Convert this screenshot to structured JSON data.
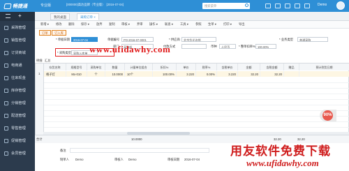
{
  "app": {
    "name": "畅捷通",
    "edition": "专业版",
    "info": "[000000]高达品牌（专业版）　[2016-07-04]"
  },
  "topbar": {
    "search_placeholder": "搜索菜单",
    "user": "Demo"
  },
  "sidebar": {
    "home_glyph": "+",
    "items": [
      {
        "label": "采购管理",
        "icon": "cart-icon"
      },
      {
        "label": "销售管理",
        "icon": "tag-icon"
      },
      {
        "label": "订货商城",
        "icon": "shop-icon"
      },
      {
        "label": "电商通",
        "icon": "globe-icon"
      },
      {
        "label": "往来现金",
        "icon": "wallet-icon"
      },
      {
        "label": "库存管理",
        "icon": "box-icon"
      },
      {
        "label": "分销管理",
        "icon": "branch-icon"
      },
      {
        "label": "配送管理",
        "icon": "truck-icon"
      },
      {
        "label": "零售管理",
        "icon": "store-icon"
      },
      {
        "label": "促销管理",
        "icon": "gift-icon"
      },
      {
        "label": "会员管理",
        "icon": "user-icon"
      }
    ]
  },
  "tabs": [
    {
      "label": "我的桌面",
      "active": false
    },
    {
      "label": "采购订单 ×",
      "active": true
    }
  ],
  "menu": [
    "新增 ▾",
    "修改",
    "删除",
    "保存 ▾",
    "放弃",
    "复制",
    "审核 ▾",
    "弃审",
    "操作 ▾",
    "联查 ▾",
    "工具 ▾",
    "参照",
    "生单 ▾",
    "打印 ▾",
    "导出"
  ],
  "actions": {
    "btn1": "订单",
    "btn2": "订入库"
  },
  "form": {
    "date_label": "* 单据日期",
    "date_value": "2016-07-04",
    "code_label": "单据编号",
    "code_value": "PO-2016-07-0001",
    "supplier_label": "* 供应商",
    "supplier_value": "北京华光连锁",
    "bustype_label": "* 业务类型",
    "bustype_value": "普通采购",
    "dept_label": "部门",
    "dept_value": "采购部",
    "payment_label": "付款方式",
    "payment_value": "",
    "currency_label": "币种",
    "currency_value": "人民币",
    "taxrate_label": "* 整单扣率%",
    "taxrate_value": "100.00%",
    "type_label": "* 采购类型",
    "type_value": "采购入库单"
  },
  "watermark": {
    "url": "www.ufidawhy.com",
    "cn": "用友软件免费下载",
    "en": "www.ufidawhy.com"
  },
  "grid": {
    "tabs": [
      "明细",
      "汇总"
    ],
    "headers": [
      "存货名称",
      "规格型号",
      "采购单位",
      "数量",
      "计量单位组合",
      "折扣%",
      "单价",
      "税率%",
      "含税单价",
      "金额",
      "含税金额",
      "赠品",
      "预计到货日期"
    ],
    "rows": [
      {
        "no": "1",
        "cells": [
          "格子灯",
          "Mx-010",
          "个",
          "10.0000",
          "10个",
          "100.00%",
          "3.220",
          "0.00%",
          "3.220",
          "32.20",
          "32.20",
          "",
          ""
        ]
      }
    ],
    "total_label": "合计",
    "total_qty": "10.0000",
    "total_amount": "32.20",
    "total_tax_amount": "32.20"
  },
  "footer": {
    "remark_label": "备注",
    "maker_label": "制单人",
    "maker_value": "Demo",
    "auditor_label": "审核人",
    "auditor_value": "Demo",
    "auditdate_label": "审核日期",
    "auditdate_value": "2016-07-04"
  },
  "badge": {
    "value": "90%",
    "color": "#e85a4f"
  },
  "colors": {
    "topbar": "#2e8fd6",
    "sidebar": "#2c3b4d",
    "accent": "#e0801a",
    "watermark": "#e01818"
  }
}
